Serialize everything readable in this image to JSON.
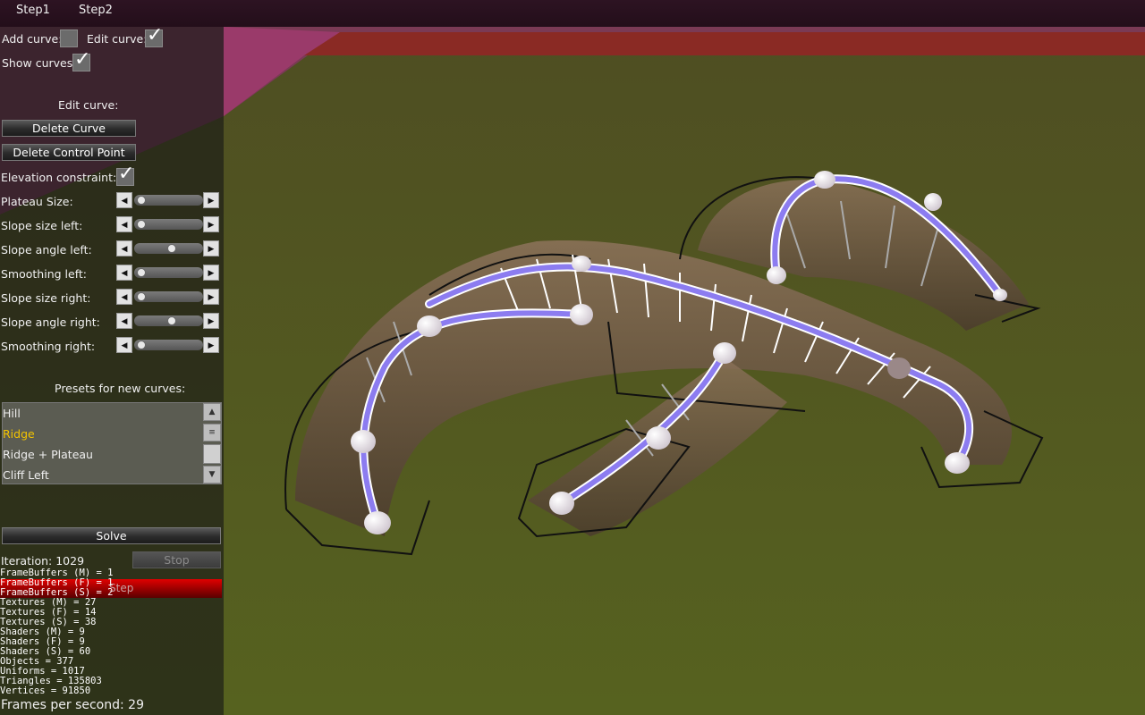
{
  "menu": [
    "Step1",
    "Step2"
  ],
  "panel": {
    "add_curve_label": "Add curve:",
    "add_curve_checked": false,
    "edit_curve_label": "Edit curve:",
    "edit_curve_checked": true,
    "show_curves_label": "Show curves:",
    "show_curves_checked": true,
    "edit_section_title": "Edit curve:",
    "delete_curve": "Delete Curve",
    "delete_control_point": "Delete Control Point",
    "elevation_label": "Elevation constraint:",
    "elevation_checked": true,
    "sliders": [
      {
        "label": "Plateau Size:",
        "value": 0.05
      },
      {
        "label": "Slope size left:",
        "value": 0.05
      },
      {
        "label": "Slope angle left:",
        "value": 0.55
      },
      {
        "label": "Smoothing left:",
        "value": 0.05
      },
      {
        "label": "Slope size right:",
        "value": 0.05
      },
      {
        "label": "Slope angle right:",
        "value": 0.55
      },
      {
        "label": "Smoothing right:",
        "value": 0.05
      }
    ],
    "presets_title": "Presets for new curves:",
    "presets": [
      "Hill",
      "Ridge",
      "Ridge + Plateau",
      "Cliff Left"
    ],
    "selected_preset": "Ridge",
    "solve": "Solve",
    "iteration": "Iteration: 1029",
    "stop": "Stop",
    "step_hidden": "Step",
    "fps": "Frames per second: 29"
  },
  "stats": [
    "FrameBuffers (M) = 1",
    "FrameBuffers (F) = 1",
    "FrameBuffers (S) = 2",
    "Textures (M) = 27",
    "Textures (F) = 14",
    "Textures (S) = 38",
    "Shaders (M) = 9",
    "Shaders (F) = 9",
    "Shaders (S) = 60",
    "Objects = 377",
    "Uniforms = 1017",
    "Triangles = 135803",
    "Vertices = 91850"
  ],
  "colors": {
    "curve": "#8c7cf0",
    "ground": "#5a5a28",
    "terrain": "#6e5a44",
    "selected_text": "#f2c300"
  }
}
